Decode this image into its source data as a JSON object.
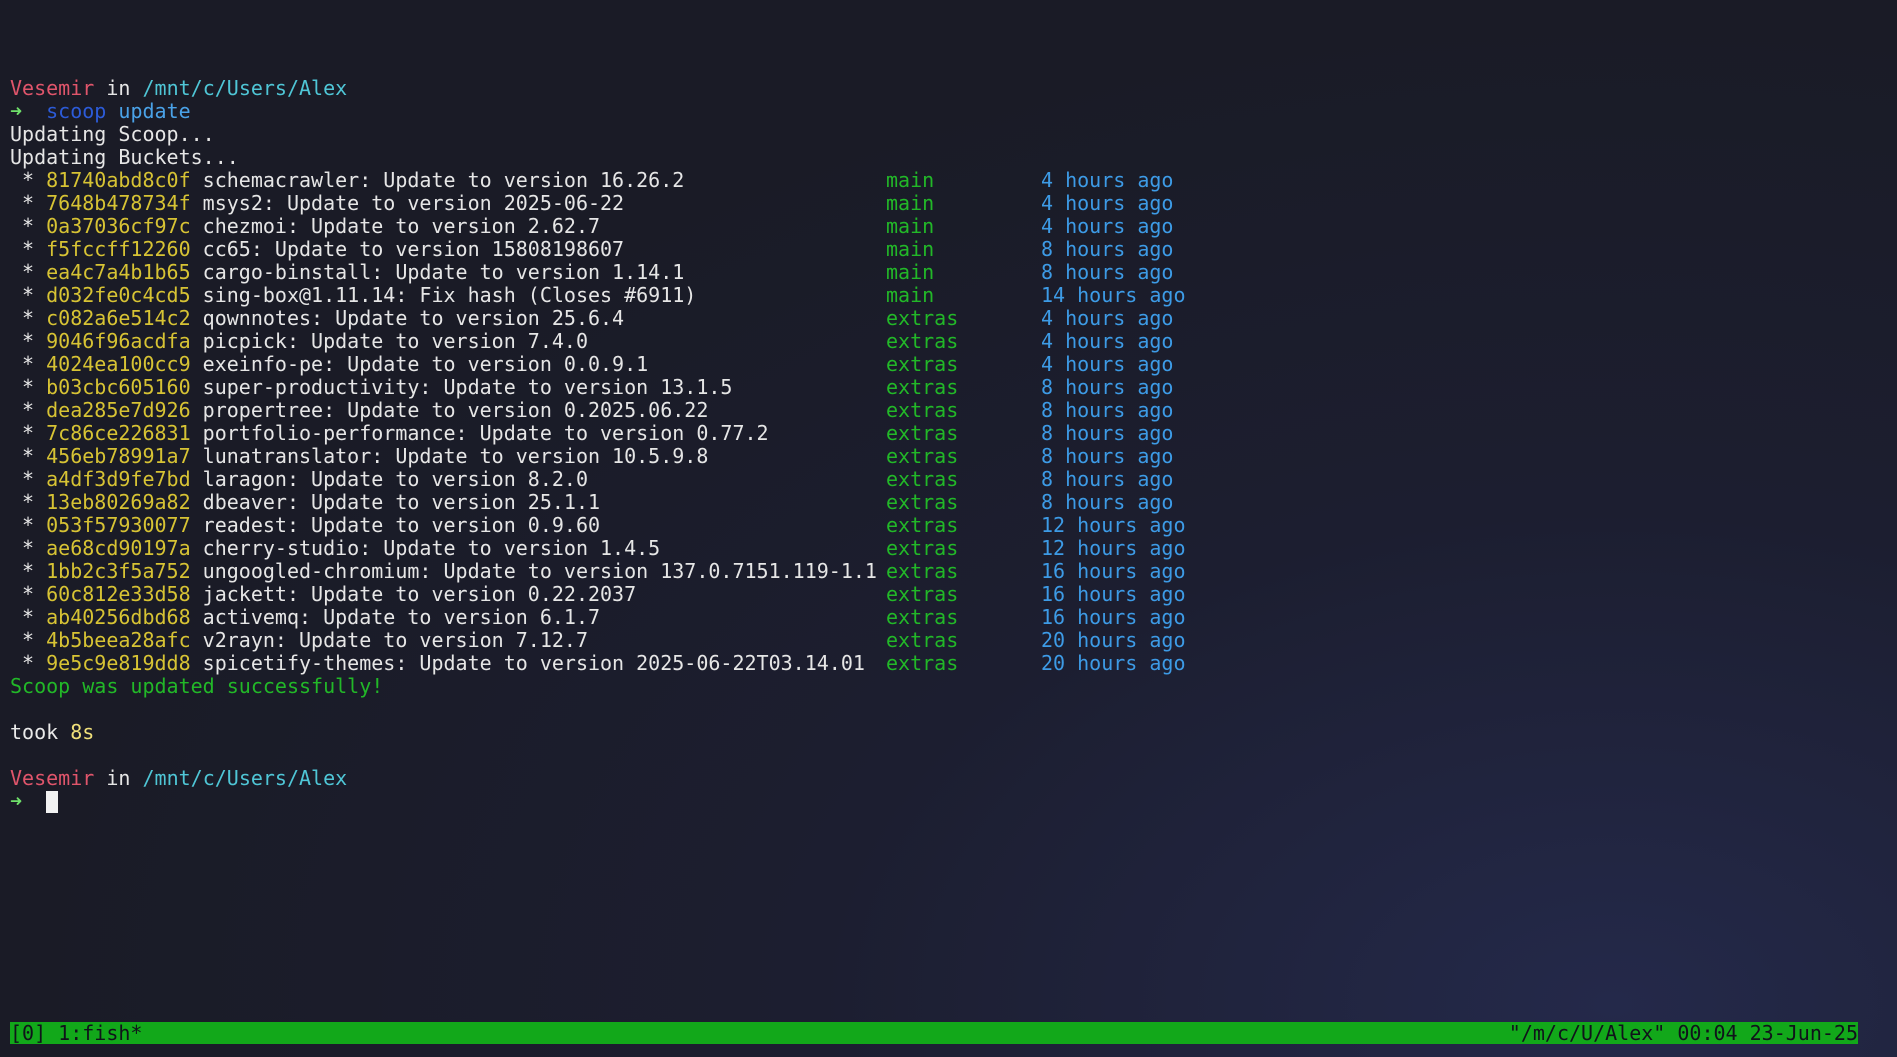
{
  "prompt": {
    "user": "Vesemir",
    "in_word": "in",
    "path": "/mnt/c/Users/Alex",
    "arrow": "➜"
  },
  "command": {
    "name": "scoop",
    "arg": "update"
  },
  "output": {
    "updating_scoop": "Updating Scoop...",
    "updating_buckets": "Updating Buckets...",
    "commits": [
      {
        "bullet": " * ",
        "hash": "81740abd8c0f",
        "message": " schemacrawler: Update to version 16.26.2",
        "bucket": "main",
        "time": "4 hours ago"
      },
      {
        "bullet": " * ",
        "hash": "7648b478734f",
        "message": " msys2: Update to version 2025-06-22",
        "bucket": "main",
        "time": "4 hours ago"
      },
      {
        "bullet": " * ",
        "hash": "0a37036cf97c",
        "message": " chezmoi: Update to version 2.62.7",
        "bucket": "main",
        "time": "4 hours ago"
      },
      {
        "bullet": " * ",
        "hash": "f5fccff12260",
        "message": " cc65: Update to version 15808198607",
        "bucket": "main",
        "time": "8 hours ago"
      },
      {
        "bullet": " * ",
        "hash": "ea4c7a4b1b65",
        "message": " cargo-binstall: Update to version 1.14.1",
        "bucket": "main",
        "time": "8 hours ago"
      },
      {
        "bullet": " * ",
        "hash": "d032fe0c4cd5",
        "message": " sing-box@1.11.14: Fix hash (Closes #6911)",
        "bucket": "main",
        "time": "14 hours ago"
      },
      {
        "bullet": " * ",
        "hash": "c082a6e514c2",
        "message": " qownnotes: Update to version 25.6.4",
        "bucket": "extras",
        "time": "4 hours ago"
      },
      {
        "bullet": " * ",
        "hash": "9046f96acdfa",
        "message": " picpick: Update to version 7.4.0",
        "bucket": "extras",
        "time": "4 hours ago"
      },
      {
        "bullet": " * ",
        "hash": "4024ea100cc9",
        "message": " exeinfo-pe: Update to version 0.0.9.1",
        "bucket": "extras",
        "time": "4 hours ago"
      },
      {
        "bullet": " * ",
        "hash": "b03cbc605160",
        "message": " super-productivity: Update to version 13.1.5",
        "bucket": "extras",
        "time": "8 hours ago"
      },
      {
        "bullet": " * ",
        "hash": "dea285e7d926",
        "message": " propertree: Update to version 0.2025.06.22",
        "bucket": "extras",
        "time": "8 hours ago"
      },
      {
        "bullet": " * ",
        "hash": "7c86ce226831",
        "message": " portfolio-performance: Update to version 0.77.2",
        "bucket": "extras",
        "time": "8 hours ago"
      },
      {
        "bullet": " * ",
        "hash": "456eb78991a7",
        "message": " lunatranslator: Update to version 10.5.9.8",
        "bucket": "extras",
        "time": "8 hours ago"
      },
      {
        "bullet": " * ",
        "hash": "a4df3d9fe7bd",
        "message": " laragon: Update to version 8.2.0",
        "bucket": "extras",
        "time": "8 hours ago"
      },
      {
        "bullet": " * ",
        "hash": "13eb80269a82",
        "message": " dbeaver: Update to version 25.1.1",
        "bucket": "extras",
        "time": "8 hours ago"
      },
      {
        "bullet": " * ",
        "hash": "053f57930077",
        "message": " readest: Update to version 0.9.60",
        "bucket": "extras",
        "time": "12 hours ago"
      },
      {
        "bullet": " * ",
        "hash": "ae68cd90197a",
        "message": " cherry-studio: Update to version 1.4.5",
        "bucket": "extras",
        "time": "12 hours ago"
      },
      {
        "bullet": " * ",
        "hash": "1bb2c3f5a752",
        "message": " ungoogled-chromium: Update to version 137.0.7151.119-1.1",
        "bucket": "extras",
        "time": "16 hours ago"
      },
      {
        "bullet": " * ",
        "hash": "60c812e33d58",
        "message": " jackett: Update to version 0.22.2037",
        "bucket": "extras",
        "time": "16 hours ago"
      },
      {
        "bullet": " * ",
        "hash": "ab40256dbd68",
        "message": " activemq: Update to version 6.1.7",
        "bucket": "extras",
        "time": "16 hours ago"
      },
      {
        "bullet": " * ",
        "hash": "4b5beea28afc",
        "message": " v2rayn: Update to version 7.12.7",
        "bucket": "extras",
        "time": "20 hours ago"
      },
      {
        "bullet": " * ",
        "hash": "9e5c9e819dd8",
        "message": " spicetify-themes: Update to version 2025-06-22T03.14.01",
        "bucket": "extras",
        "time": "20 hours ago"
      }
    ],
    "success": "Scoop was updated successfully!",
    "took_label": "took ",
    "took_value": "8s"
  },
  "statusbar": {
    "left": "[0] 1:fish*",
    "right": "\"/m/c/U/Alex\" 00:04 23-Jun-25"
  },
  "colors": {
    "background": "#1a1b26",
    "prompt_user": "#e0556b",
    "prompt_path": "#4fc6d6",
    "hash": "#d7c334",
    "bucket": "#22b828",
    "time": "#3d9be6",
    "statusbar": "#12a81a"
  }
}
